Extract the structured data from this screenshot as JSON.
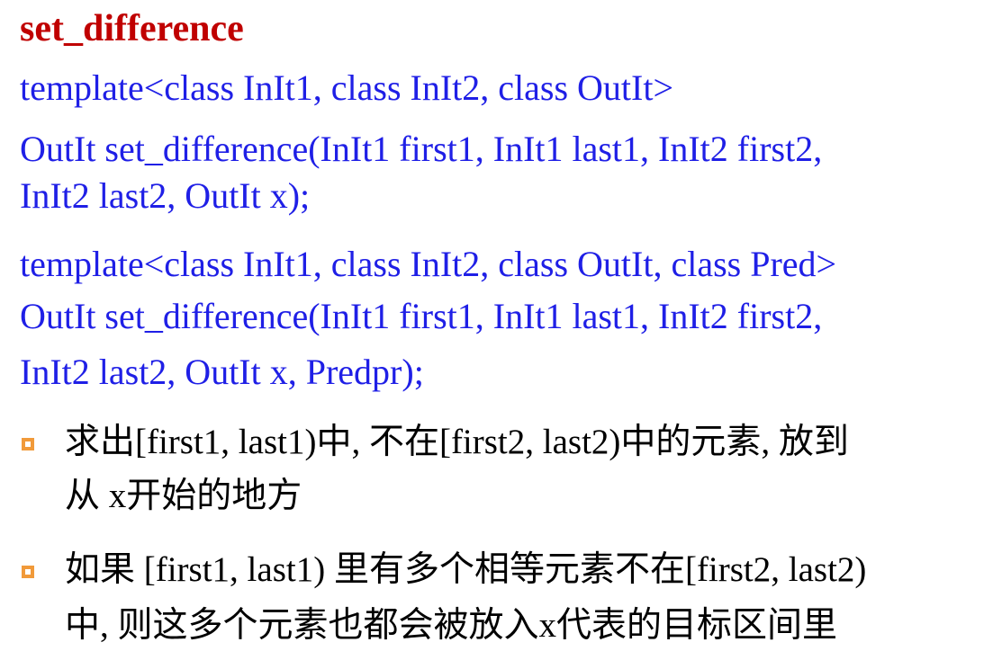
{
  "title": "set_difference",
  "signature1": {
    "template": "template<class InIt1, class InIt2, class OutIt>",
    "line1": "OutIt set_difference(InIt1 first1, InIt1 last1, InIt2 first2,",
    "line2": "InIt2 last2, OutIt x);"
  },
  "signature2": {
    "template": "template<class InIt1, class InIt2, class OutIt, class Pred>",
    "line1": "OutIt set_difference(InIt1 first1, InIt1 last1, InIt2 first2,",
    "line2": "InIt2 last2, OutIt x, Predpr);"
  },
  "bullets": [
    {
      "line1": "求出[first1, last1)中, 不在[first2, last2)中的元素, 放到",
      "line2": "从 x开始的地方"
    },
    {
      "line1": "如果 [first1, last1) 里有多个相等元素不在[first2, last2)",
      "line2": "中, 则这多个元素也都会被放入x代表的目标区间里"
    }
  ],
  "colors": {
    "title": "#c00000",
    "code": "#1f1fe6",
    "bullet_marker": "#f19a3a",
    "text": "#000000"
  }
}
